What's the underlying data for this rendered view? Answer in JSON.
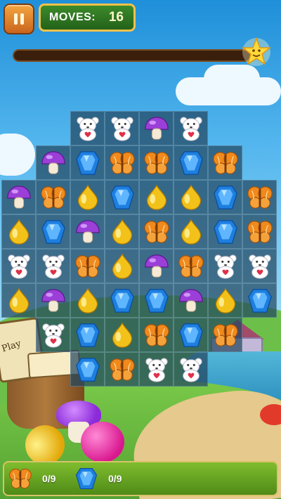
{
  "hud": {
    "pause_icon": "pause-icon",
    "moves_label": "MOVES:",
    "moves_value": "16",
    "level_progress": 0.0,
    "progress_star_icon": "star-icon"
  },
  "board": {
    "rows": [
      [
        null,
        null,
        "bear",
        "bear",
        "mushroom",
        "bear",
        null,
        null
      ],
      [
        null,
        "mushroom",
        "gem",
        "butterfly",
        "butterfly",
        "gem",
        "butterfly",
        null
      ],
      [
        "mushroom",
        "butterfly",
        "drop",
        "gem",
        "drop",
        "drop",
        "gem",
        "butterfly"
      ],
      [
        "drop",
        "gem",
        "mushroom",
        "drop",
        "butterfly",
        "drop",
        "gem",
        "butterfly"
      ],
      [
        "bear",
        "bear",
        "butterfly",
        "drop",
        "mushroom",
        "butterfly",
        "bear",
        "bear"
      ],
      [
        "drop",
        "mushroom",
        "drop",
        "gem",
        "gem",
        "mushroom",
        "drop",
        "gem"
      ],
      [
        null,
        "bear",
        "gem",
        "drop",
        "butterfly",
        "gem",
        "butterfly",
        null
      ],
      [
        null,
        null,
        "gem",
        "butterfly",
        "bear",
        "bear",
        null,
        null
      ]
    ]
  },
  "scenery": {
    "book_label": "Play"
  },
  "goals": [
    {
      "piece": "butterfly",
      "count": "0/9"
    },
    {
      "piece": "gem",
      "count": "0/9"
    }
  ],
  "colors": {
    "butterfly": "#f08a1c",
    "gem": "#1e7fe0",
    "drop": "#f2c21a",
    "mushroom": "#9b3fd8",
    "bear": "#ffffff",
    "bear_heart": "#e0304a"
  }
}
